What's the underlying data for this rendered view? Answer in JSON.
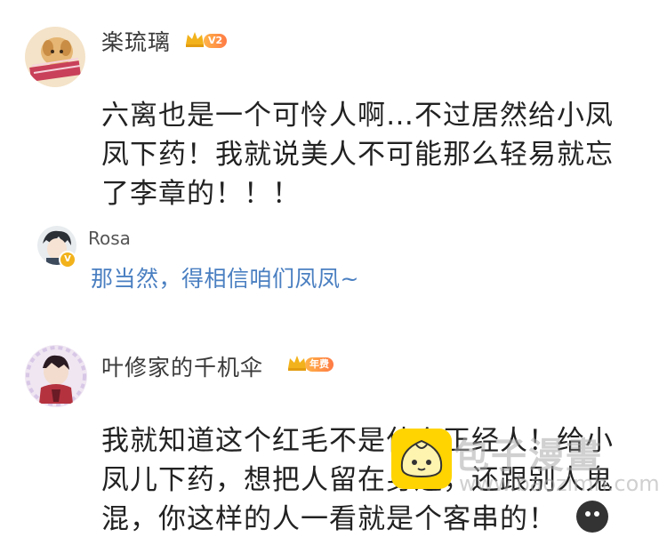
{
  "comments": [
    {
      "username": "楽琉璃",
      "badge": "V2",
      "lines": [
        "六离也是一个可怜人啊…不过居然给小凤",
        "凤下药！我就说美人不可能那么轻易就忘",
        "了李章的！！！"
      ],
      "reply": {
        "username": "Rosa",
        "verified_mark": "V",
        "text": "那当然，得相信咱们凤凤~"
      }
    },
    {
      "username": "叶修家的千机伞",
      "badge": "年费",
      "lines": [
        "我就知道这个红毛不是什么正经人！给小",
        "凤儿下药，想把人留在身边，还跟别人鬼",
        "混，你这样的人一看就是个客串的！"
      ]
    }
  ],
  "watermark": {
    "text": "包子漫畫",
    "url": "www.baozimh.com"
  },
  "colors": {
    "reply_text": "#4a7fc1",
    "badge_start": "#ffb347",
    "badge_end": "#ff7a45",
    "crown": "#f2b21b"
  }
}
